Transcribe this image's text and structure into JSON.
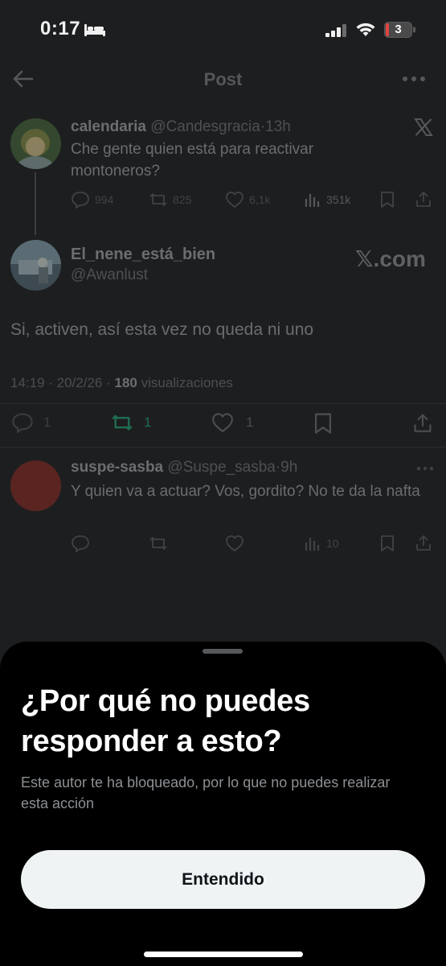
{
  "status_bar": {
    "time": "0:17",
    "battery": "3"
  },
  "header": {
    "title": "Post"
  },
  "tweet1": {
    "name": "calendaria",
    "handle": "@Candesgracia",
    "time": "13h",
    "text": "Che gente quien está para reactivar montoneros?",
    "replies": "994",
    "reposts": "825",
    "likes": "6,1k",
    "views": "351k"
  },
  "tweet2": {
    "name": "El_nene_está_bien",
    "handle": "@Awanlust",
    "watermark": "𝕏.com",
    "text": "Si, activen, así esta vez no queda ni uno",
    "timestamp": "14:19 · 20/2/26 · ",
    "views_count": "180",
    "views_label": " visualizaciones",
    "replies": "1",
    "reposts": "1",
    "likes": "1"
  },
  "reply": {
    "name": "suspe-sasba",
    "handle": "@Suspe_sasba",
    "time": "9h",
    "text": "Y quien va a actuar? Vos, gordito? No te da la nafta",
    "views": "10"
  },
  "sheet": {
    "title": "¿Por qué no puedes responder a esto?",
    "body": "Este autor te ha bloqueado, por lo que no puedes realizar esta acción",
    "button": "Entendido"
  },
  "colors": {
    "accent_repost": "#00ba7c",
    "button_bg": "#eff3f4",
    "sheet_bg": "#000000"
  }
}
